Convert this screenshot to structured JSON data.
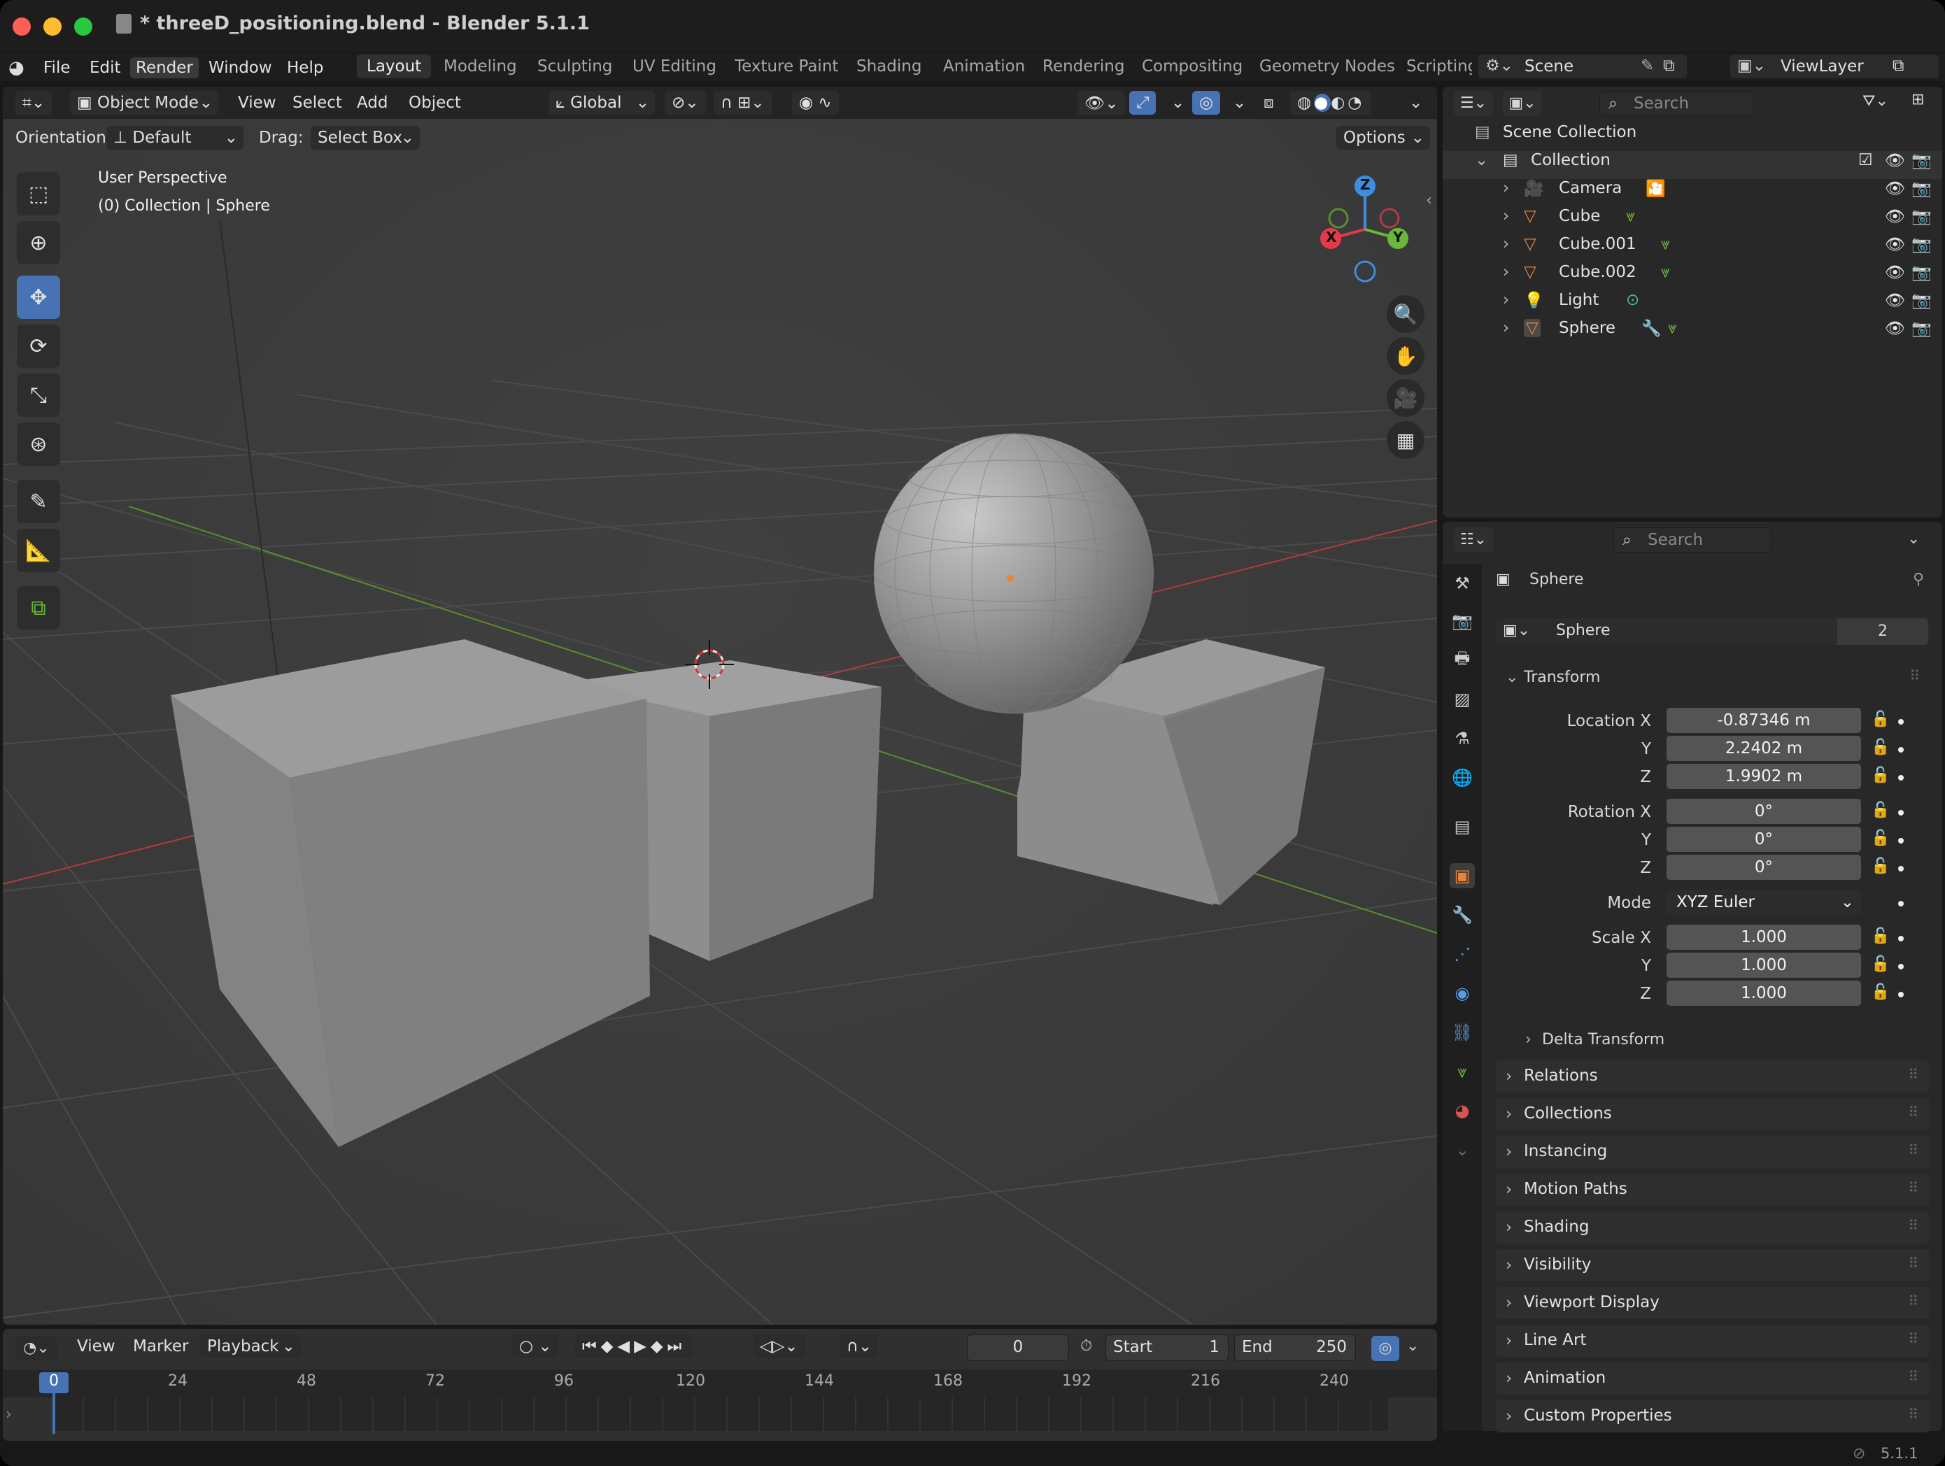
{
  "window": {
    "title": "* threeD_positioning.blend - Blender 5.1.1",
    "version": "5.1.1"
  },
  "menu": {
    "items": [
      "File",
      "Edit",
      "Render",
      "Window",
      "Help"
    ],
    "active": "Render"
  },
  "workspaces": {
    "tabs": [
      "Layout",
      "Modeling",
      "Sculpting",
      "UV Editing",
      "Texture Paint",
      "Shading",
      "Animation",
      "Rendering",
      "Compositing",
      "Geometry Nodes",
      "Scripting"
    ],
    "active": "Layout"
  },
  "scene": {
    "name": "Scene",
    "view_layer": "ViewLayer"
  },
  "viewport": {
    "header": {
      "mode": "Object Mode",
      "view": "View",
      "select": "Select",
      "add": "Add",
      "object": "Object",
      "orientation": "Global"
    },
    "tool_header": {
      "orientation_label": "Orientation:",
      "orientation_value": "Default",
      "drag_label": "Drag:",
      "drag_value": "Select Box",
      "options": "Options"
    },
    "overlay_text": {
      "line1": "User Perspective",
      "line2": "(0) Collection | Sphere"
    },
    "gizmo": {
      "x": "X",
      "y": "Y",
      "z": "Z"
    }
  },
  "outliner": {
    "search_placeholder": "Search",
    "root": "Scene Collection",
    "collection": "Collection",
    "items": [
      {
        "name": "Camera"
      },
      {
        "name": "Cube"
      },
      {
        "name": "Cube.001"
      },
      {
        "name": "Cube.002"
      },
      {
        "name": "Light"
      },
      {
        "name": "Sphere"
      }
    ]
  },
  "properties": {
    "search_placeholder": "Search",
    "object_name": "Sphere",
    "data_name": "Sphere",
    "users": "2",
    "transform_title": "Transform",
    "location": {
      "label": "Location X",
      "x": "-0.87346 m",
      "y": "2.2402 m",
      "z": "1.9902 m"
    },
    "rotation": {
      "label": "Rotation X",
      "x": "0°",
      "y": "0°",
      "z": "0°"
    },
    "mode": {
      "label": "Mode",
      "value": "XYZ Euler"
    },
    "scale": {
      "label": "Scale X",
      "x": "1.000",
      "y": "1.000",
      "z": "1.000"
    },
    "axis_labels": {
      "y": "Y",
      "z": "Z"
    },
    "delta": "Delta Transform",
    "panels": [
      "Relations",
      "Collections",
      "Instancing",
      "Motion Paths",
      "Shading",
      "Visibility",
      "Viewport Display",
      "Line Art",
      "Animation",
      "Custom Properties"
    ]
  },
  "timeline": {
    "menus": [
      "View",
      "Marker",
      "Playback"
    ],
    "current_frame": "0",
    "start_label": "Start",
    "start": "1",
    "end_label": "End",
    "end": "250",
    "ruler": [
      "0",
      "24",
      "48",
      "72",
      "96",
      "120",
      "144",
      "168",
      "192",
      "216",
      "240"
    ]
  },
  "colors": {
    "accent": "#4772b3",
    "x_axis": "#e33b4b",
    "y_axis": "#6ab83a",
    "z_axis": "#3d8ee0",
    "orange": "#e8833a"
  }
}
